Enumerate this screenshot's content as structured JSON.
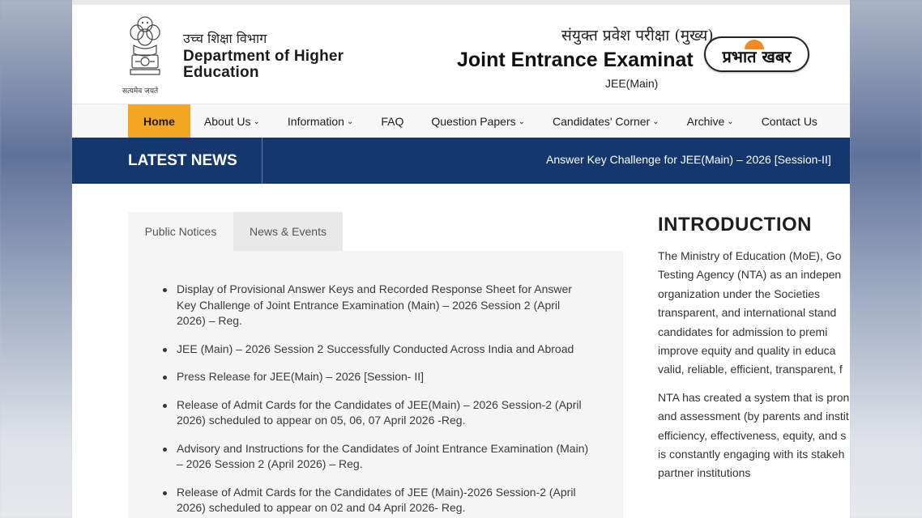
{
  "header": {
    "dept_hindi": "उच्च शिक्षा विभाग",
    "dept_name": "Department of Higher Education",
    "emblem_motto": "सत्यमेव जयते",
    "exam_hindi": "संयुक्त प्रवेश परीक्षा (मुख्य)",
    "exam_name": "Joint Entrance Examinat",
    "exam_short": "JEE(Main)",
    "watermark": "प्रभात खबर"
  },
  "nav": {
    "items": [
      {
        "label": "Home",
        "active": true,
        "caret": false
      },
      {
        "label": "About Us",
        "caret": true
      },
      {
        "label": "Information",
        "caret": true
      },
      {
        "label": "FAQ",
        "caret": false
      },
      {
        "label": "Question Papers",
        "caret": true
      },
      {
        "label": "Candidates' Corner",
        "caret": true
      },
      {
        "label": "Archive",
        "caret": true
      },
      {
        "label": "Contact Us",
        "caret": false
      }
    ]
  },
  "news": {
    "title": "LATEST NEWS",
    "ticker": "Answer Key Challenge for JEE(Main) – 2026 [Session-II]"
  },
  "tabs": {
    "public_notices": "Public Notices",
    "news_events": "News & Events"
  },
  "notices": [
    "Display of Provisional Answer Keys and Recorded Response Sheet for Answer Key Challenge of Joint Entrance Examination (Main) – 2026 Session 2 (April 2026) – Reg.",
    "JEE (Main) – 2026 Session 2 Successfully Conducted Across India and Abroad",
    "Press Release for JEE(Main) – 2026 [Session- II]",
    "Release of Admit Cards for the Candidates of JEE(Main) – 2026 Session-2 (April 2026) scheduled to appear on 05, 06, 07 April 2026 -Reg.",
    "Advisory and Instructions for the Candidates of Joint Entrance Examination (Main) – 2026 Session 2 (April 2026) – Reg.",
    "Release of Admit Cards for the Candidates of JEE (Main)-2026 Session-2 (April 2026) scheduled to appear on 02 and 04 April 2026- Reg."
  ],
  "intro": {
    "title": "INTRODUCTION",
    "para1": [
      "The Ministry of Education (MoE), Go",
      "Testing Agency (NTA) as an indepen",
      "organization  under  the  Societies",
      "transparent, and international stand",
      "candidates for admission to premi",
      "improve equity and quality in educa",
      "valid, reliable, efficient, transparent, f"
    ],
    "para2": [
      "NTA has created a system that is pron",
      "and assessment (by parents and instit",
      "efficiency, effectiveness, equity, and s",
      "is constantly engaging with its stakeh",
      "partner institutions"
    ]
  }
}
